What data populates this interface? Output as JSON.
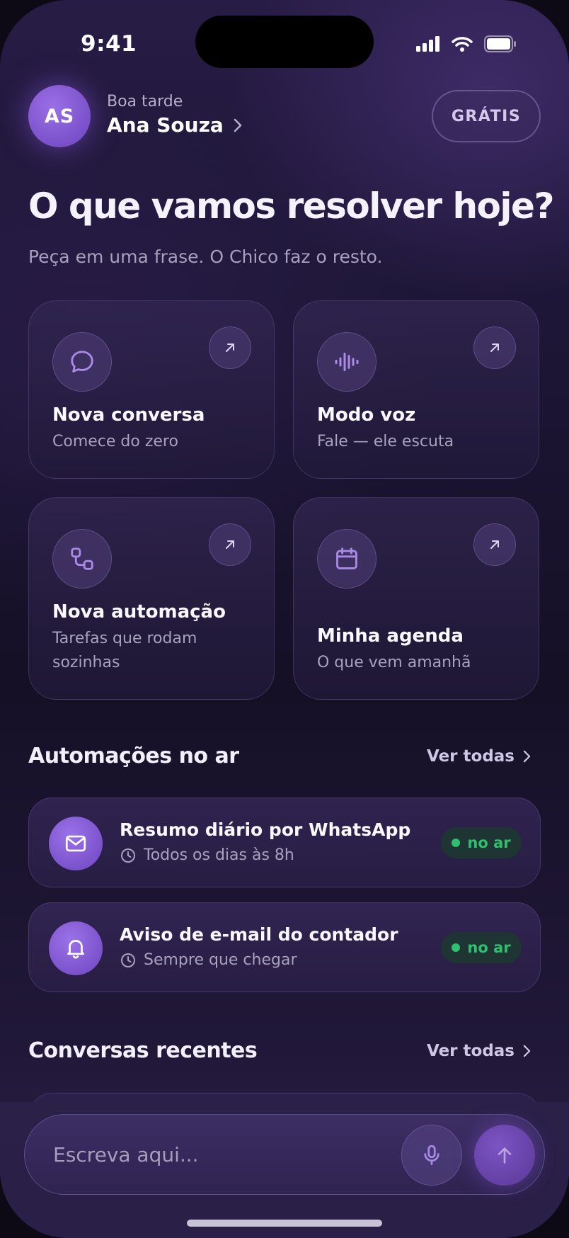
{
  "status_bar": {
    "time": "9:41"
  },
  "header": {
    "avatar_initials": "AS",
    "greeting": "Boa tarde",
    "user_name": "Ana Souza",
    "plan_label": "GRÁTIS"
  },
  "hero": {
    "title": "O que vamos resolver hoje?",
    "subtitle": "Peça em uma frase. O Chico faz o resto."
  },
  "quick_actions": [
    {
      "title": "Nova conversa",
      "description": "Comece do zero",
      "icon": "chat-bubble-icon"
    },
    {
      "title": "Modo voz",
      "description": "Fale — ele escuta",
      "icon": "waveform-icon"
    },
    {
      "title": "Nova automação",
      "description": "Tarefas que rodam sozinhas",
      "icon": "workflow-icon"
    },
    {
      "title": "Minha agenda",
      "description": "O que vem amanhã",
      "icon": "calendar-icon"
    }
  ],
  "automations": {
    "title": "Automações no ar",
    "see_all": "Ver todas",
    "items": [
      {
        "title": "Resumo diário por WhatsApp",
        "schedule": "Todos os dias às 8h",
        "status": "no ar",
        "icon": "mail-icon"
      },
      {
        "title": "Aviso de e-mail do contador",
        "schedule": "Sempre que chegar",
        "status": "no ar",
        "icon": "bell-icon"
      }
    ]
  },
  "recent": {
    "title": "Conversas recentes",
    "see_all": "Ver todas"
  },
  "composer": {
    "placeholder": "Escreva aqui..."
  },
  "colors": {
    "accent": "#7c54c4",
    "status_green": "#2fbf6f",
    "background": "#1c1534"
  }
}
